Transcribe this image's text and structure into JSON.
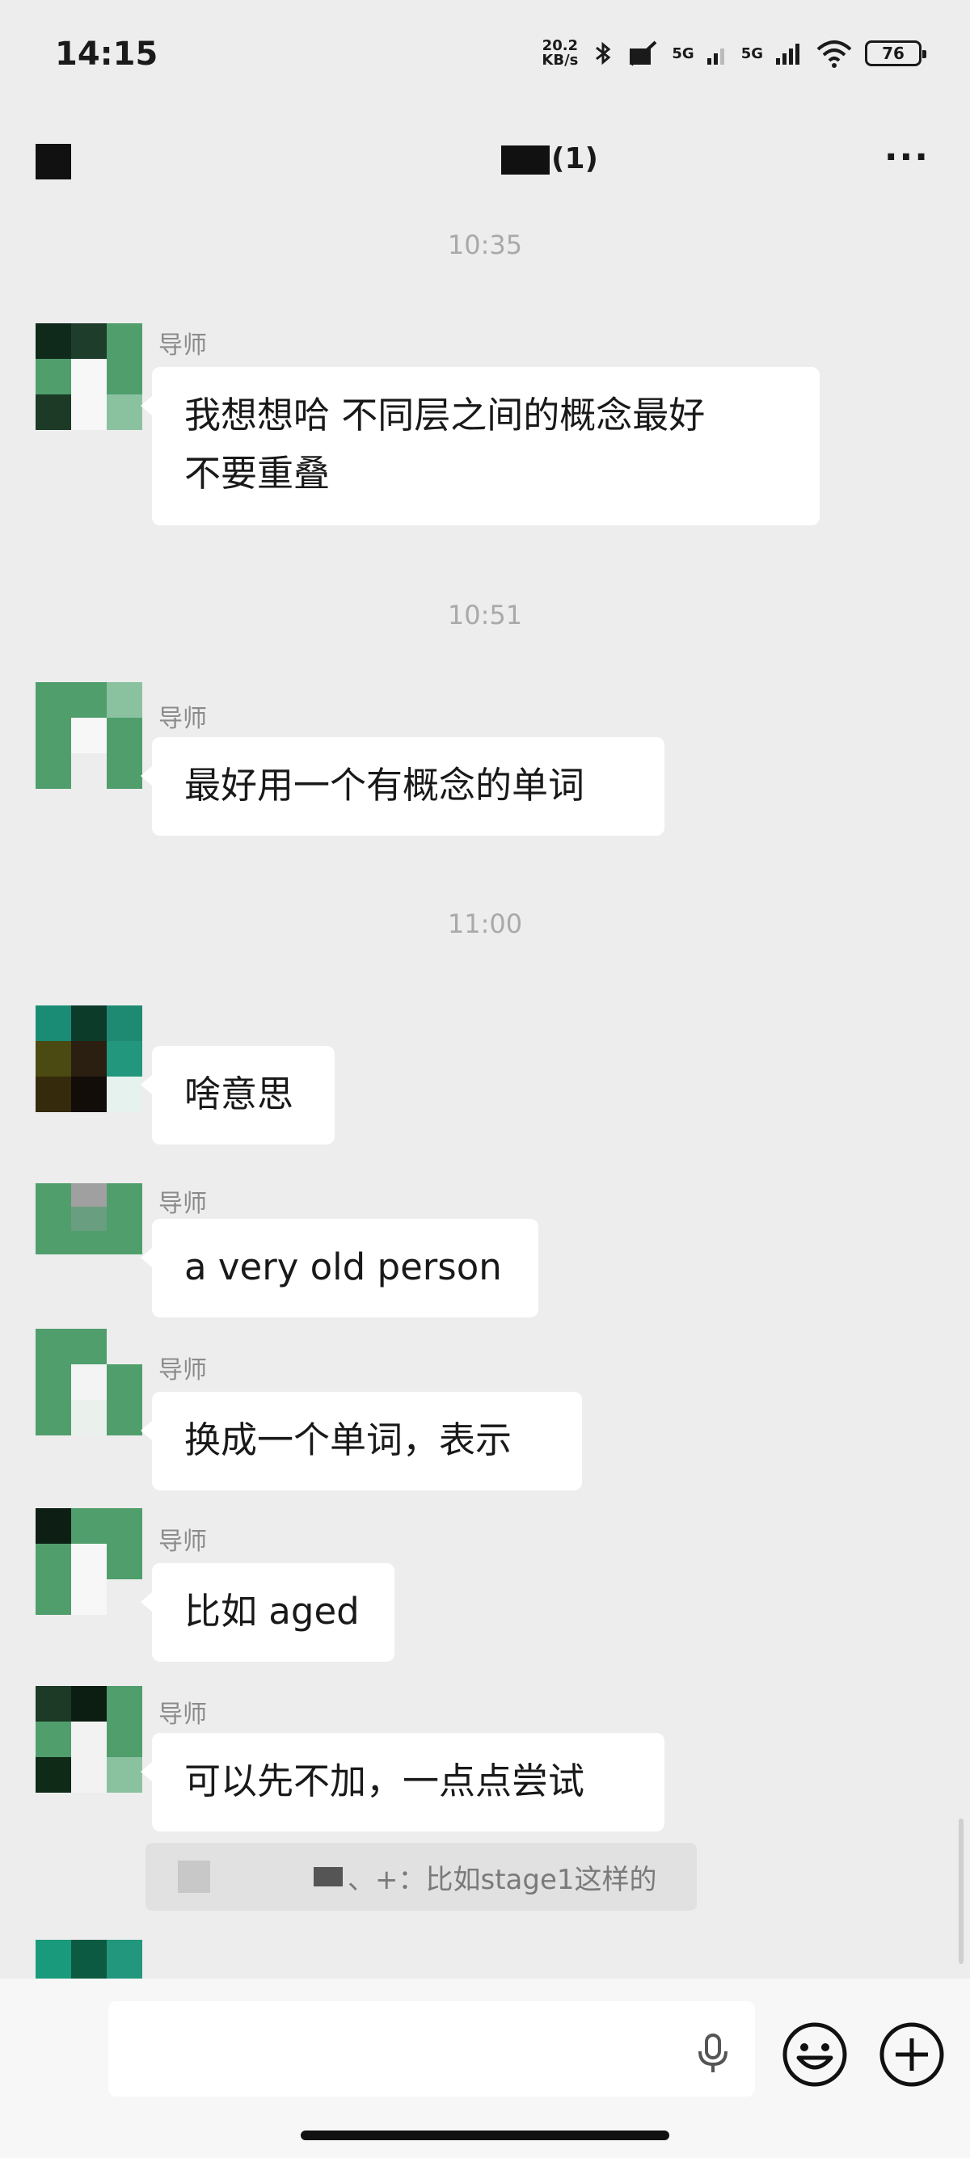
{
  "status_bar": {
    "time": "14:15",
    "net_speed_top": "20.2",
    "net_speed_bottom": "KB/s",
    "sig1": "5G",
    "sig2": "5G",
    "battery": "76"
  },
  "nav": {
    "title_visible": "(1)"
  },
  "chat": {
    "timestamps": [
      "10:35",
      "10:51",
      "11:00"
    ],
    "messages": [
      {
        "sender": "导师",
        "line1": "我想想哈 不同层之间的概念最好",
        "line2": "不要重叠"
      },
      {
        "sender": "导师",
        "text": "最好用一个有概念的单词"
      },
      {
        "text": "啥意思"
      },
      {
        "sender": "导师",
        "text": "a very old person"
      },
      {
        "sender": "导师",
        "text": "换成一个单词，表示"
      },
      {
        "sender": "导师",
        "text": "比如 aged"
      },
      {
        "sender": "导师",
        "text": "可以先不加，一点点尝试"
      }
    ],
    "quote": {
      "separator": "、+：",
      "text": "比如stage1这样的"
    }
  },
  "input_bar": {
    "placeholder": ""
  },
  "colors": {
    "background": "#ededed",
    "bubble": "#ffffff",
    "timestamp": "#a9a9a9",
    "sender": "#8b8b8b",
    "avatar_green": "#4f9e6c"
  }
}
